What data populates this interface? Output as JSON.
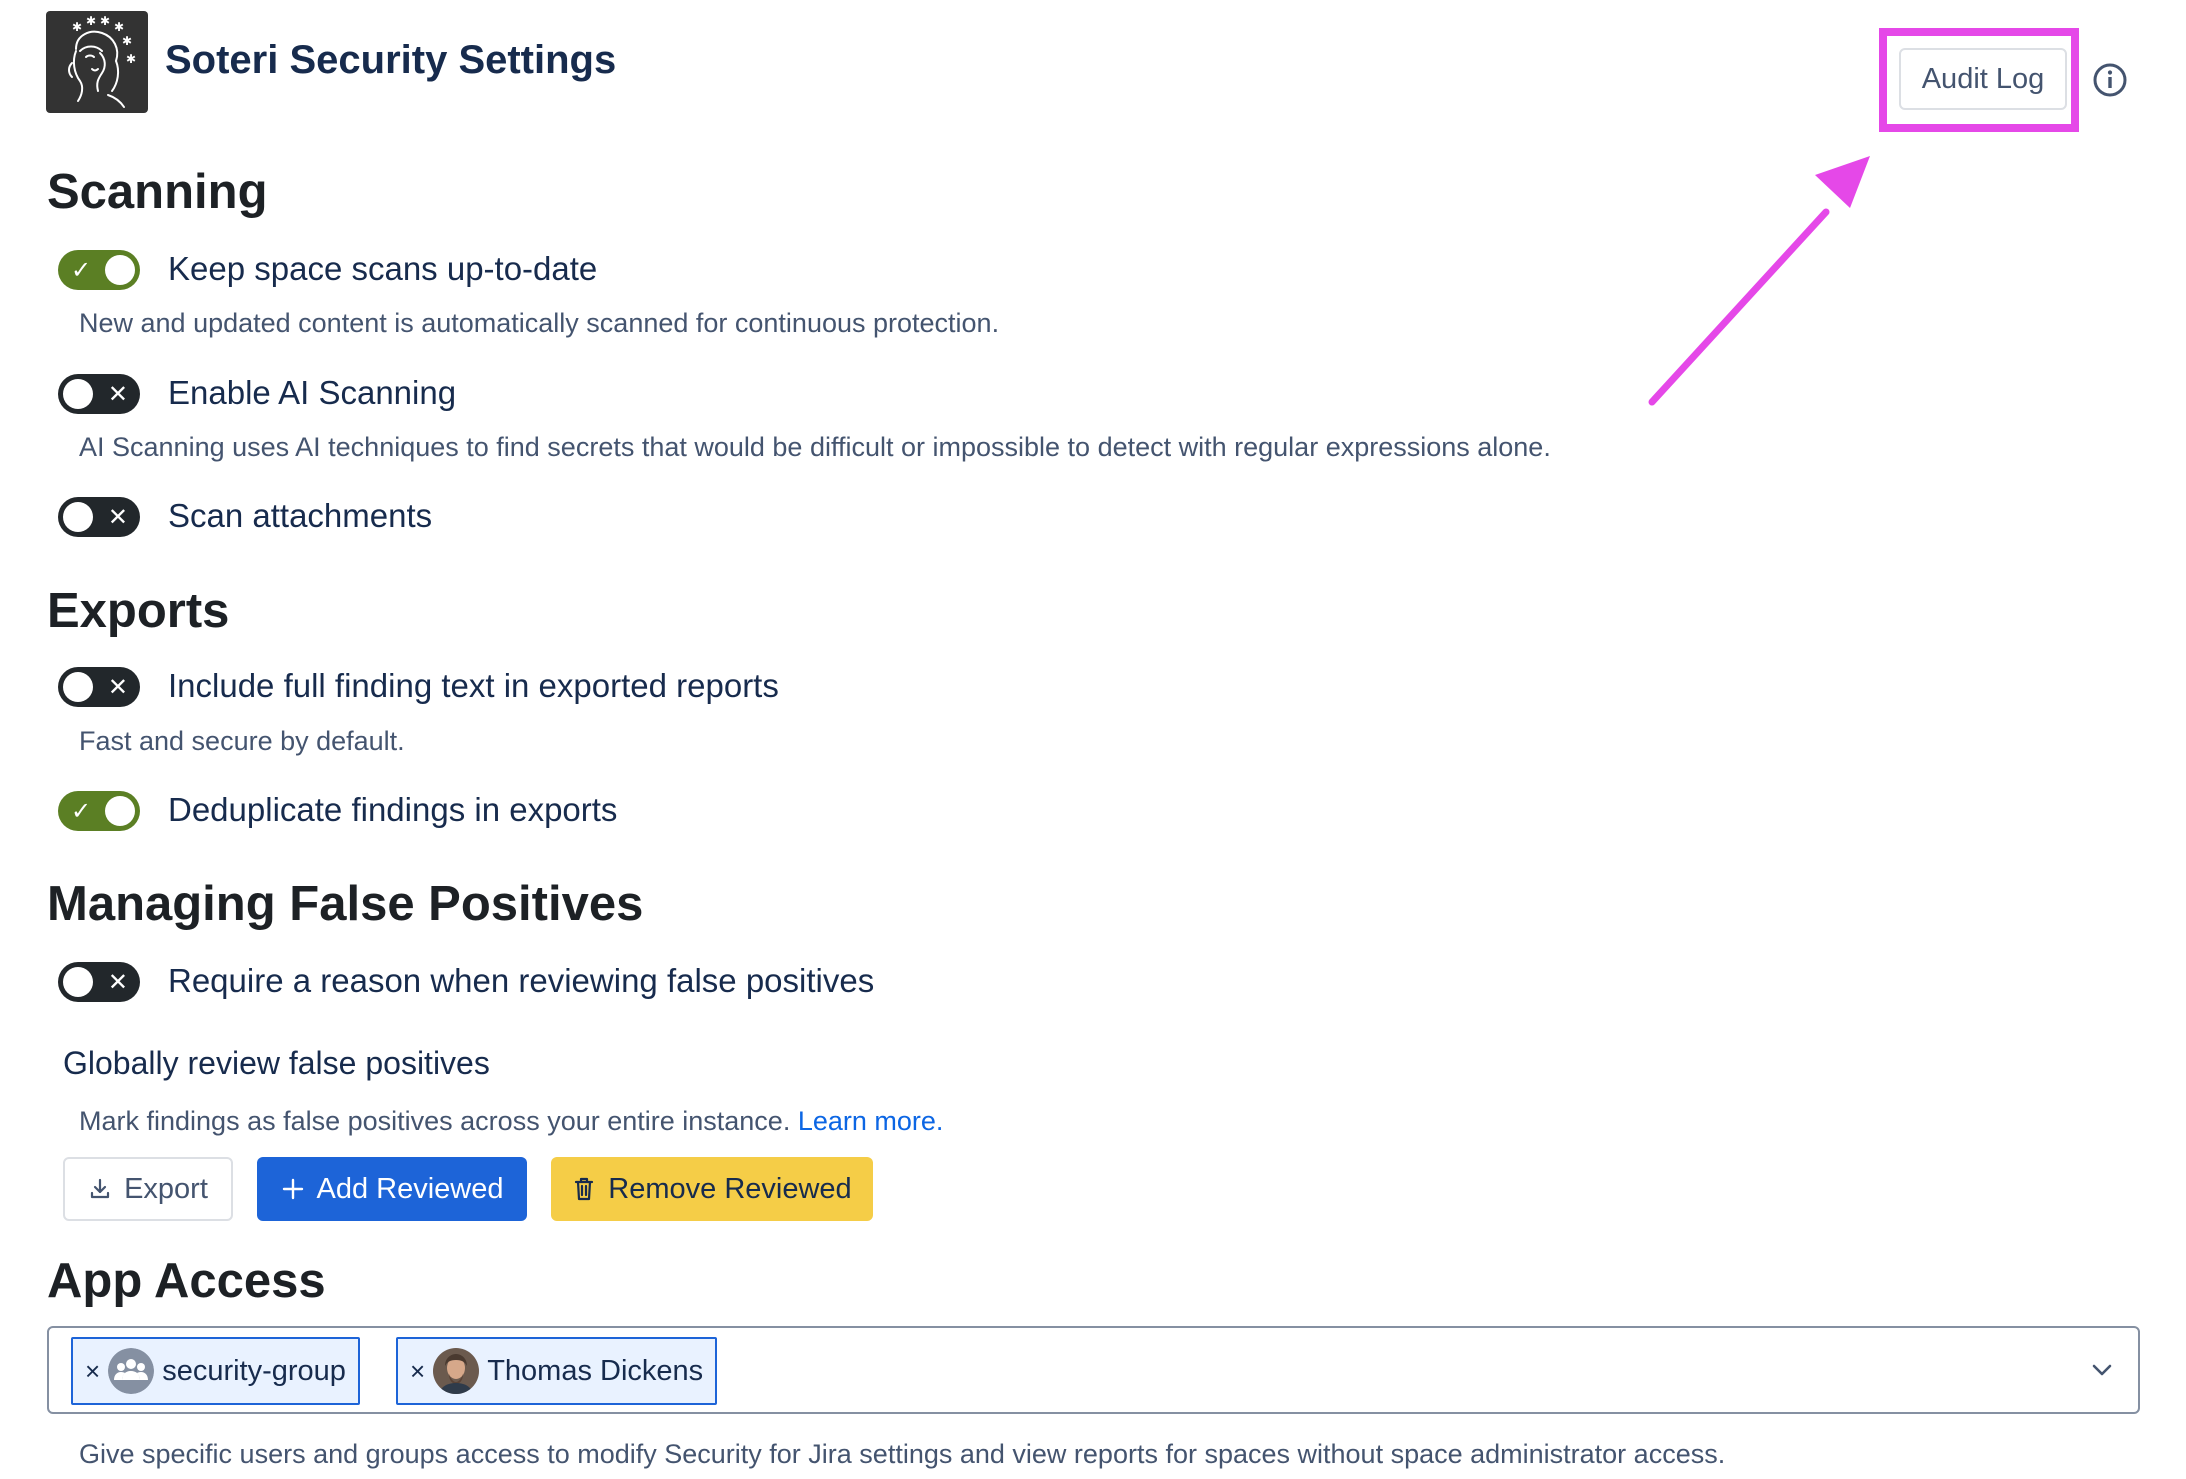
{
  "header": {
    "app_title": "Soteri Security Settings",
    "audit_log_label": "Audit Log",
    "logo_icon": "soteri-goddess-logo",
    "info_icon": "info-icon",
    "highlight_color": "#e548e8"
  },
  "scanning": {
    "title": "Scanning",
    "keep_scans": {
      "label": "Keep space scans up-to-date",
      "enabled": true,
      "description": "New and updated content is automatically scanned for continuous protection."
    },
    "ai_scanning": {
      "label": "Enable AI Scanning",
      "enabled": false,
      "description": "AI Scanning uses AI techniques to find secrets that would be difficult or impossible to detect with regular expressions alone."
    },
    "attachments": {
      "label": "Scan attachments",
      "enabled": false
    }
  },
  "exports": {
    "title": "Exports",
    "full_text": {
      "label": "Include full finding text in exported reports",
      "enabled": false,
      "description": "Fast and secure by default."
    },
    "dedupe": {
      "label": "Deduplicate findings in exports",
      "enabled": true
    }
  },
  "false_positives": {
    "title": "Managing False Positives",
    "require_reason": {
      "label": "Require a reason when reviewing false positives",
      "enabled": false
    },
    "global_title": "Globally review false positives",
    "global_description": "Mark findings as false positives across your entire instance.",
    "learn_more": "Learn more.",
    "export_label": "Export",
    "add_label": "Add Reviewed",
    "remove_label": "Remove Reviewed"
  },
  "app_access": {
    "title": "App Access",
    "chips": [
      {
        "label": "security-group",
        "remove": "×"
      },
      {
        "label": "Thomas Dickens",
        "remove": "×"
      }
    ],
    "description": "Give specific users and groups access to modify Security for Jira settings and view reports for spaces without space administrator access."
  },
  "colors": {
    "toggle_on": "#5b7f24",
    "toggle_off": "#22272b",
    "primary": "#1d64d8",
    "warning": "#f5cd47",
    "link": "#0c66e4"
  }
}
